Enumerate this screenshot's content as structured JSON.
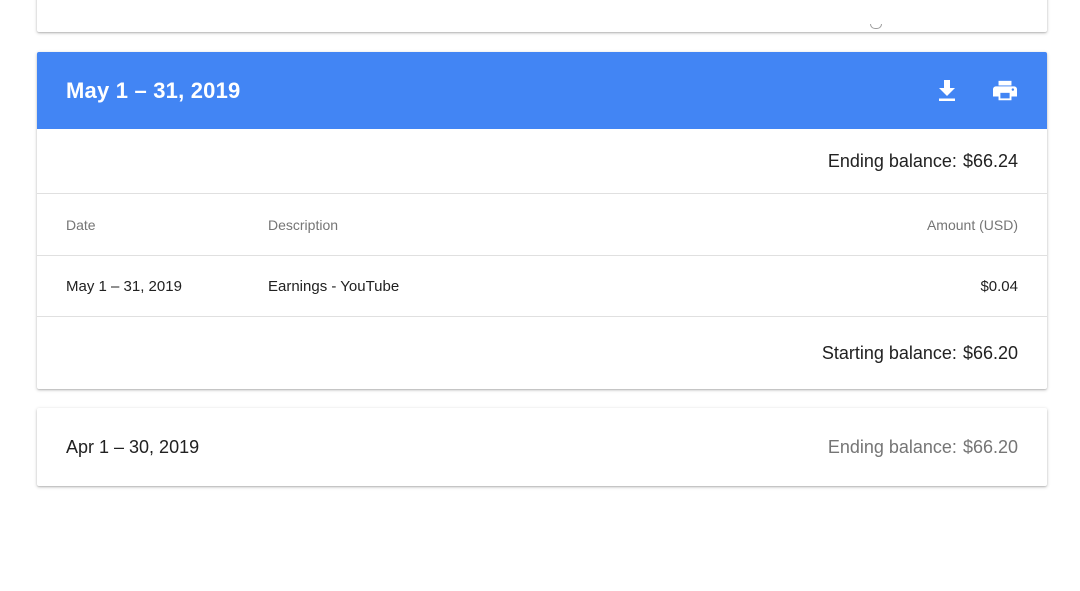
{
  "statement_may": {
    "title": "May 1 – 31, 2019",
    "ending_balance_label": "Ending balance:",
    "ending_balance_value": "$66.24",
    "columns": {
      "date": "Date",
      "description": "Description",
      "amount": "Amount (USD)"
    },
    "rows": [
      {
        "date": "May 1 – 31, 2019",
        "description": "Earnings - YouTube",
        "amount": "$0.04"
      }
    ],
    "starting_balance_label": "Starting balance:",
    "starting_balance_value": "$66.20",
    "header_color": "#4285f4",
    "icons": [
      "download-icon",
      "print-icon"
    ]
  },
  "statement_apr": {
    "title": "Apr 1 – 30, 2019",
    "ending_balance_label": "Ending balance:",
    "ending_balance_value": "$66.20"
  }
}
